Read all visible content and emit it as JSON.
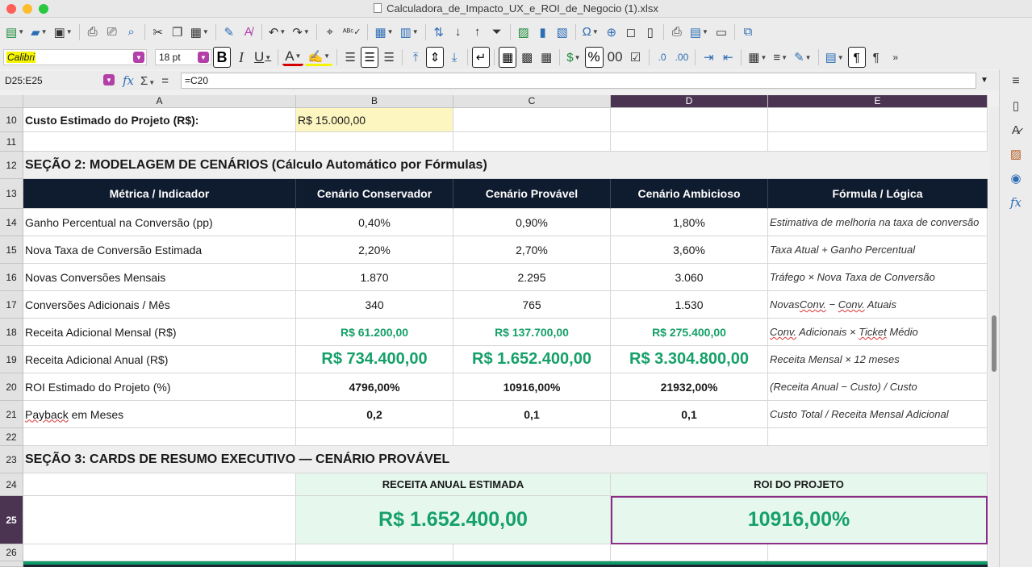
{
  "window": {
    "title": "Calculadora_de_Impacto_UX_e_ROI_de_Negocio (1).xlsx"
  },
  "toolbar": {
    "font_name": "Calibri",
    "font_size": "18 pt",
    "bold_label": "B",
    "italic_label": "I",
    "underline_label": "U",
    "percent_label": "%",
    "zero_label": "00",
    "number_labels": [
      ".0",
      ".00"
    ]
  },
  "formula_bar": {
    "cell_ref": "D25:E25",
    "formula": "=C20",
    "fx": "fx",
    "sum": "Σ",
    "equals": "="
  },
  "columns": [
    {
      "id": "A",
      "label": "A"
    },
    {
      "id": "B",
      "label": "B"
    },
    {
      "id": "C",
      "label": "C"
    },
    {
      "id": "D",
      "label": "D"
    },
    {
      "id": "E",
      "label": "E"
    }
  ],
  "rows": {
    "r10": {
      "num": "10",
      "a": "Custo Estimado do Projeto (R$):",
      "b": "R$ 15.000,00"
    },
    "r11": {
      "num": "11"
    },
    "r12": {
      "num": "12",
      "a": "SEÇÃO 2: MODELAGEM DE CENÁRIOS (Cálculo Automático por Fórmulas)"
    },
    "r13": {
      "num": "13",
      "a": "Métrica / Indicador",
      "b": "Cenário Conservador",
      "c": "Cenário Provável",
      "d": "Cenário Ambicioso",
      "e": "Fórmula / Lógica"
    },
    "r14": {
      "num": "14",
      "a": "Ganho Percentual na Conversão (pp)",
      "b": "0,40%",
      "c": "0,90%",
      "d": "1,80%",
      "e": "Estimativa de melhoria na taxa de conversão"
    },
    "r15": {
      "num": "15",
      "a": "Nova Taxa de Conversão Estimada",
      "b": "2,20%",
      "c": "2,70%",
      "d": "3,60%",
      "e": "Taxa Atual + Ganho Percentual"
    },
    "r16": {
      "num": "16",
      "a": "Novas Conversões Mensais",
      "b": "1.870",
      "c": "2.295",
      "d": "3.060",
      "e": "Tráfego × Nova Taxa de Conversão"
    },
    "r17": {
      "num": "17",
      "a": "Conversões Adicionais / Mês",
      "b": "340",
      "c": "765",
      "d": "1.530",
      "e_pre": "Novas ",
      "e_w1": "Conv.",
      "e_mid": " − ",
      "e_w2": "Conv.",
      "e_post": " Atuais"
    },
    "r18": {
      "num": "18",
      "a": "Receita Adicional Mensal (R$)",
      "b": "R$ 61.200,00",
      "c": "R$ 137.700,00",
      "d": "R$ 275.400,00",
      "e_w1": "Conv.",
      "e_mid": " Adicionais × ",
      "e_w2": "Ticket",
      "e_post": " Médio"
    },
    "r19": {
      "num": "19",
      "a": "Receita Adicional Anual (R$)",
      "b": "R$ 734.400,00",
      "c": "R$ 1.652.400,00",
      "d": "R$ 3.304.800,00",
      "e": "Receita Mensal × 12 meses"
    },
    "r20": {
      "num": "20",
      "a": "ROI Estimado do Projeto (%)",
      "b": "4796,00%",
      "c": "10916,00%",
      "d": "21932,00%",
      "e": "(Receita Anual − Custo) / Custo"
    },
    "r21": {
      "num": "21",
      "a_w1": "Payback",
      "a_post": " em Meses",
      "b": "0,2",
      "c": "0,1",
      "d": "0,1",
      "e": "Custo Total / Receita Mensal Adicional"
    },
    "r22": {
      "num": "22"
    },
    "r23": {
      "num": "23",
      "a": "SEÇÃO 3: CARDS DE RESUMO EXECUTIVO — CENÁRIO PROVÁVEL"
    },
    "r24": {
      "num": "24",
      "bc": "RECEITA ANUAL ESTIMADA",
      "de": "ROI DO PROJETO"
    },
    "r25": {
      "num": "25",
      "bc": "R$ 1.652.400,00",
      "de": "10916,00%"
    },
    "r26": {
      "num": "26"
    }
  },
  "colors": {
    "header_bg": "#0f1b2e",
    "accent_green": "#16a06a",
    "card_bg": "#e6f8ee",
    "selection": "#8b2d86",
    "input_yellow": "#fdf6c0"
  }
}
